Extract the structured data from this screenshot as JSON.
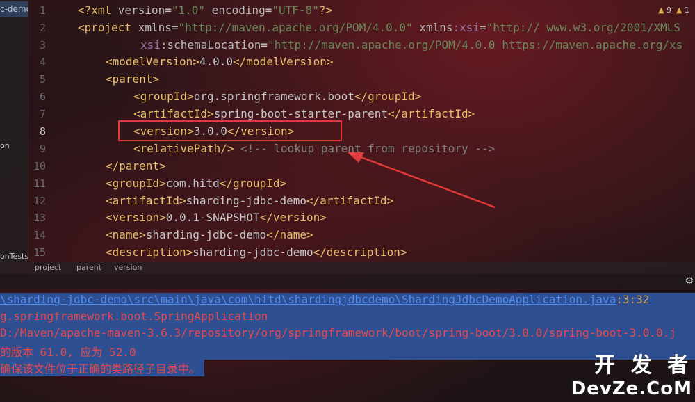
{
  "left_strip": {
    "tab_label": "c-demo",
    "label_on": "on",
    "label_tests": "onTests"
  },
  "inspection": {
    "warnings": "9",
    "weak_warnings": "1"
  },
  "editor": {
    "line_numbers": [
      "1",
      "2",
      "3",
      "4",
      "5",
      "6",
      "7",
      "8",
      "9",
      "10",
      "11",
      "12",
      "13",
      "14",
      "15"
    ],
    "lines": {
      "l1": {
        "a": "<?xml ",
        "b": "version",
        "c": "=",
        "d": "\"1.0\"",
        "e": " encoding",
        "f": "=",
        "g": "\"UTF-8\"",
        "h": "?>"
      },
      "l2": {
        "a": "<project ",
        "b": "xmlns",
        "c": "=",
        "d": "\"http://maven.apache.org/POM/4.0.0\"",
        "e": " xmlns",
        "f": ":xsi",
        "g": "=",
        "h": "\"http:// www.w3.org/2001/XMLS"
      },
      "l3": {
        "a": "xsi",
        "b": ":schemaLocation",
        "c": "=",
        "d": "\"http://maven.apache.org/POM/4.0.0 https://maven.apache.org/xs"
      },
      "l4": {
        "a": "<modelVersion>",
        "b": "4.0.0",
        "c": "</modelVersion>"
      },
      "l5": {
        "a": "<parent>"
      },
      "l6": {
        "a": "<groupId>",
        "b": "org.springframework.boot",
        "c": "</groupId>"
      },
      "l7": {
        "a": "<artifactId>",
        "b": "spring-boot-starter-parent",
        "c": "</artifactId>"
      },
      "l8": {
        "a": "<version>",
        "b": "3.0.0",
        "c": "</version>"
      },
      "l9": {
        "a": "<relativePath/>",
        "b": " <!-- lookup parent from repository -->"
      },
      "l10": {
        "a": "</parent>"
      },
      "l11": {
        "a": "<groupId>",
        "b": "com.hitd",
        "c": "</groupId>"
      },
      "l12": {
        "a": "<artifactId>",
        "b": "sharding-jdbc-demo",
        "c": "</artifactId>"
      },
      "l13": {
        "a": "<version>",
        "b": "0.0.1-SNAPSHOT",
        "c": "</version>"
      },
      "l14": {
        "a": "<name>",
        "b": "sharding-jdbc-demo",
        "c": "</name>"
      },
      "l15": {
        "a": "<description>",
        "b": "sharding-jdbc-demo",
        "c": "</description>"
      }
    }
  },
  "breadcrumb": [
    "project",
    "parent",
    "version"
  ],
  "console": {
    "path_link": "\\sharding-jdbc-demo\\src\\main\\java\\com\\hitd\\shardingjdbcdemo\\ShardingJdbcDemoApplication.java",
    "path_loc": ":3:32",
    "line2": "g.springframework.boot.SpringApplication",
    "line3": "D:/Maven/apache-maven-3.6.3/repository/org/springframework/boot/spring-boot/3.0.0/spring-boot-3.0.0.j",
    "line4": "的版本 61.0, 应为 52.0",
    "line5": "确保该文件位于正确的类路径子目录中。"
  },
  "watermark": {
    "line1": "开 发 者",
    "line2": "DevZe.CoM"
  },
  "colors": {
    "highlight": "#e23a3a",
    "selection": "#2f4f93",
    "link": "#4f8df0",
    "error": "#e8494a"
  },
  "icons": {
    "warning": "warning-icon",
    "settings": "gear-icon"
  }
}
